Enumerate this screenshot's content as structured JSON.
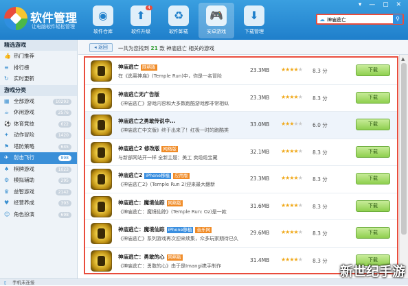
{
  "app": {
    "title": "软件管理",
    "subtitle": "让电脑软件轻松管理"
  },
  "topnav": [
    {
      "label": "软件仓库",
      "icon": "disc-icon"
    },
    {
      "label": "软件升级",
      "icon": "upgrade-icon",
      "badge": "4"
    },
    {
      "label": "软件卸载",
      "icon": "recycle-icon"
    },
    {
      "label": "安卓游戏",
      "icon": "game-icon"
    },
    {
      "label": "下载管理",
      "icon": "download-icon"
    }
  ],
  "search": {
    "value": "神庙逃亡"
  },
  "sidebar": {
    "sec1": "精选游戏",
    "featured": [
      "热门推荐",
      "排行榜",
      "实时更新"
    ],
    "sec2": "游戏分类",
    "cats": [
      {
        "label": "全部游戏",
        "count": "10293"
      },
      {
        "label": "休闲游戏",
        "count": "2576"
      },
      {
        "label": "体育竞技",
        "count": "622"
      },
      {
        "label": "动作冒险",
        "count": "1420"
      },
      {
        "label": "塔防策略",
        "count": "645"
      },
      {
        "label": "射击飞行",
        "count": "898"
      },
      {
        "label": "棋牌游戏",
        "count": "1023"
      },
      {
        "label": "模拟辅助",
        "count": "295"
      },
      {
        "label": "益智游戏",
        "count": "2142"
      },
      {
        "label": "经营养成",
        "count": "393"
      },
      {
        "label": "角色扮演",
        "count": "698"
      }
    ]
  },
  "toolbar": {
    "back": "返回",
    "prefix": "一共为您找到",
    "count": "21",
    "suffix": "款",
    "keyword": "神庙逃亡",
    "tail": "相关的游戏"
  },
  "games": [
    {
      "name": "神庙逃亡",
      "tags": [
        "网络版"
      ],
      "desc": "在《逃离神庙》(Temple Run)中，你是一名冒险",
      "size": "23.3MB",
      "stars": 4,
      "score": "8.3 分",
      "btn": "下载"
    },
    {
      "name": "神庙逃亡无广告版",
      "tags": [],
      "desc": "《神庙逃亡》游戏内容和大多数跑酷游戏都非常相似",
      "size": "23.3MB",
      "stars": 4,
      "score": "8.3 分",
      "btn": "下载"
    },
    {
      "name": "神庙逃亡之勇敢传说中...",
      "tags": [],
      "desc": "《神庙逃亡中文版》终于出来了！红极一时的跑酷类",
      "size": "33.0MB",
      "stars": 3,
      "score": "6.0 分",
      "btn": "下载"
    },
    {
      "name": "神庙逃亡2 修改版",
      "tags": [
        "网络版"
      ],
      "desc": "与新部网站开一样 全新主题：美工 卖缆缆宝藏",
      "size": "32.1MB",
      "stars": 4,
      "score": "8.3 分",
      "btn": "下载"
    },
    {
      "name": "神庙逃亡2",
      "tags": [
        "iPhone移植",
        "应用版"
      ],
      "desc": "《神庙逃亡2》(Temple Run 2)迎来最大翻新",
      "size": "23.3MB",
      "stars": 4,
      "score": "8.3 分",
      "btn": "下载"
    },
    {
      "name": "神庙逃亡：魔境仙踪",
      "tags": [
        "网络版"
      ],
      "desc": "《神庙逃亡：魔镜仙踪》(Temple Run: Oz)是一款",
      "size": "31.6MB",
      "stars": 4,
      "score": "8.3 分",
      "btn": "下载"
    },
    {
      "name": "神庙逃亡：魔境仙踪",
      "tags": [
        "iPhone移植",
        "音乐网"
      ],
      "desc": "《神庙逃亡》系列游戏再次迎来续集，众多玩家期待已久",
      "size": "29.6MB",
      "stars": 4,
      "score": "8.3 分",
      "btn": "下载"
    },
    {
      "name": "神庙逃亡：勇敢的心",
      "tags": [
        "网络版"
      ],
      "desc": "《神庙逃亡：勇敢的心》由于是Imangi携手制作",
      "size": "31.4MB",
      "stars": 4,
      "score": "8.3 分",
      "btn": "下载"
    }
  ],
  "status": {
    "text": "手机未连接"
  },
  "watermark": "新世纪手游"
}
